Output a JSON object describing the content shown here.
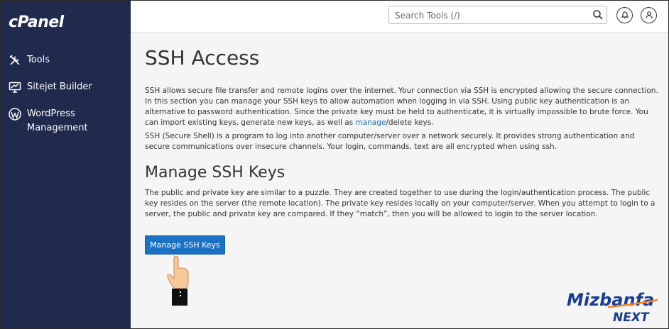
{
  "sidebar": {
    "logo": "cPanel",
    "items": [
      {
        "label": "Tools",
        "icon": "tools-icon"
      },
      {
        "label": "Sitejet Builder",
        "icon": "monitor-icon"
      },
      {
        "label": "WordPress Management",
        "icon": "wordpress-icon"
      }
    ]
  },
  "header": {
    "search_placeholder": "Search Tools (/)",
    "icons": [
      "search-icon",
      "bell-icon",
      "user-icon"
    ]
  },
  "main": {
    "title": "SSH Access",
    "intro": "SSH allows secure file transfer and remote logins over the internet. Your connection via SSH is encrypted allowing the secure connection. In this section you can manage your SSH keys to allow automation when logging in via SSH. Using public key authentication is an alternative to password authentication. Since the private key must be held to authenticate, it is virtually impossible to brute force. You can import existing keys, generate new keys, as well as",
    "intro_link": "manage",
    "intro_end": "/delete keys.",
    "secure_shell": "SSH (Secure Shell) is a program to log into another computer/server over a network securely. It provides strong authentication and secure communications over insecure channels. Your login, commands, text are all encrypted when using ssh.",
    "manage_title": "Manage SSH Keys",
    "manage_desc": "The public and private key are similar to a puzzle. They are created together to use during the login/authentication process. The public key resides on the server (the remote location). The private key resides locally on your computer/server. When you attempt to login to a server, the public and private key are compared. If they “match”, then you will be allowed to login to the server location.",
    "manage_button": "Manage SSH Keys"
  },
  "watermark": {
    "line1": "Mizbanfa",
    "line2": "NEXT",
    "colors": {
      "blue": "#1a3d8f",
      "orange": "#f5821f"
    }
  },
  "colors": {
    "sidebar_bg": "#1f2a4d",
    "button_bg": "#1b72c4",
    "link": "#1b6ec2"
  }
}
